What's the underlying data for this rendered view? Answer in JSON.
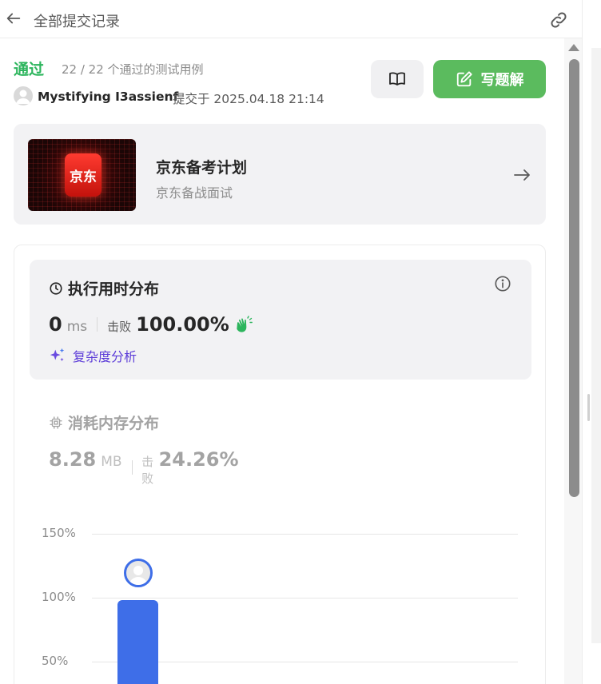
{
  "header": {
    "title": "全部提交记录"
  },
  "submission": {
    "status": "通过",
    "tests": "22 / 22 个通过的测试用例",
    "user": "Mystifying I3assienf",
    "submitted_at": "提交于 2025.04.18 21:14"
  },
  "actions": {
    "solution_label": "写题解"
  },
  "promo": {
    "logo_text": "京东",
    "title": "京东备考计划",
    "subtitle": "京东备战面试"
  },
  "runtime": {
    "title": "执行用时分布",
    "value": "0",
    "unit": "ms",
    "beat_label": "击败",
    "beat_value": "100.00%",
    "complexity_label": "复杂度分析"
  },
  "memory": {
    "title": "消耗内存分布",
    "value": "8.28",
    "unit": "MB",
    "beat_label": "击败",
    "beat_value": "24.26%"
  },
  "chart_data": {
    "type": "bar",
    "y_ticks": [
      "150%",
      "100%",
      "50%"
    ],
    "values": [
      100
    ],
    "ylim": [
      0,
      150
    ]
  },
  "colors": {
    "accent_green": "#2db55d",
    "button_green": "#5bbb5e",
    "bar_blue": "#3e6ee8",
    "complexity_purple": "#5b3bd8"
  }
}
